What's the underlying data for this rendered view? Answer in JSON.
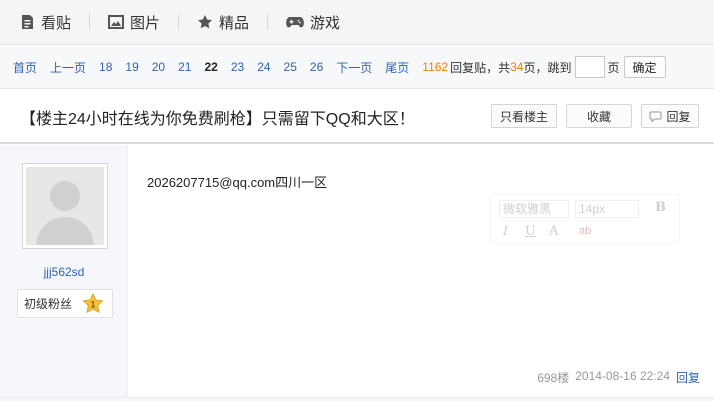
{
  "topnav": {
    "tabs": [
      {
        "label": "看贴",
        "icon": "document-icon"
      },
      {
        "label": "图片",
        "icon": "picture-icon"
      },
      {
        "label": "精品",
        "icon": "star-icon"
      },
      {
        "label": "游戏",
        "icon": "gamepad-icon"
      }
    ]
  },
  "pager": {
    "first": "首页",
    "prev": "上一页",
    "pages": [
      "18",
      "19",
      "20",
      "21",
      "22",
      "23",
      "24",
      "25",
      "26"
    ],
    "current": "22",
    "next": "下一页",
    "last": "尾页",
    "reply_count": "1162",
    "reply_label": "回复贴，共",
    "page_count": "34",
    "page_suffix": "页，跳到",
    "page_unit": "页",
    "confirm": "确定"
  },
  "thread": {
    "title": "【楼主24小时在线为你免费刷枪】只需留下QQ和大区！",
    "only_op": "只看楼主",
    "favorite": "收藏",
    "reply": "回复"
  },
  "post": {
    "username": "jjj562sd",
    "level_title": "初级粉丝",
    "level": "1",
    "content": "2026207715@qq.com四川一区",
    "floor": "698楼",
    "time": "2014-08-16 22:24",
    "reply": "回复"
  },
  "editor": {
    "font": "微软雅黑",
    "size": "14px",
    "bold": "B",
    "italic": "I",
    "underline": "U",
    "color": "A",
    "highlight": "ab"
  },
  "colors": {
    "link": "#2d64b3",
    "accent": "#f07f00"
  }
}
